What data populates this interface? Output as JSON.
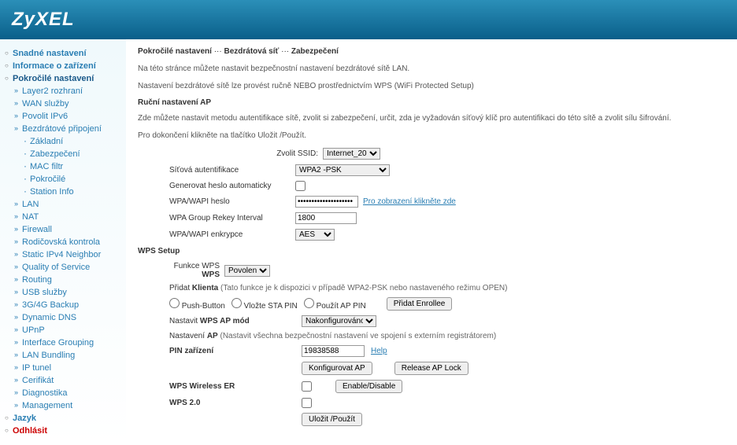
{
  "app": {
    "logo": "ZyXEL"
  },
  "sidebar": [
    {
      "t": "top",
      "label": "Snadné nastavení",
      "bold": true
    },
    {
      "t": "top",
      "label": "Informace o zařízení",
      "bold": true
    },
    {
      "t": "top",
      "label": "Pokročilé nastavení",
      "bold": true,
      "active": true
    },
    {
      "t": "sub",
      "label": "Layer2 rozhraní"
    },
    {
      "t": "sub",
      "label": "WAN služby"
    },
    {
      "t": "sub",
      "label": "Povolit IPv6"
    },
    {
      "t": "sub",
      "label": "Bezdrátové připojení"
    },
    {
      "t": "sub2",
      "label": "Základní"
    },
    {
      "t": "sub2",
      "label": "Zabezpečení"
    },
    {
      "t": "sub2",
      "label": "MAC filtr"
    },
    {
      "t": "sub2",
      "label": "Pokročilé"
    },
    {
      "t": "sub2",
      "label": "Station Info"
    },
    {
      "t": "sub",
      "label": "LAN"
    },
    {
      "t": "sub",
      "label": "NAT"
    },
    {
      "t": "sub",
      "label": "Firewall"
    },
    {
      "t": "sub",
      "label": "Rodičovská kontrola"
    },
    {
      "t": "sub",
      "label": "Static IPv4 Neighbor"
    },
    {
      "t": "sub",
      "label": "Quality of Service"
    },
    {
      "t": "sub",
      "label": "Routing"
    },
    {
      "t": "sub",
      "label": "USB služby"
    },
    {
      "t": "sub",
      "label": "3G/4G Backup"
    },
    {
      "t": "sub",
      "label": "Dynamic DNS"
    },
    {
      "t": "sub",
      "label": "UPnP"
    },
    {
      "t": "sub",
      "label": "Interface Grouping"
    },
    {
      "t": "sub",
      "label": "LAN Bundling"
    },
    {
      "t": "sub",
      "label": "IP tunel"
    },
    {
      "t": "sub",
      "label": "Cerifikát"
    },
    {
      "t": "sub",
      "label": "Diagnostika"
    },
    {
      "t": "sub",
      "label": "Management"
    },
    {
      "t": "top",
      "label": "Jazyk",
      "bold": true
    },
    {
      "t": "top",
      "label": "Odhlásit",
      "bold": true,
      "logout": true
    }
  ],
  "breadcrumb": {
    "a": "Pokročilé nastavení",
    "b": "Bezdrátová síť",
    "c": "Zabezpečení",
    "sep": "···"
  },
  "intro1": "Na této stránce můžete nastavit bezpečnostní nastavení bezdrátové sítě LAN.",
  "intro2": "Nastavení bezdrátové sítě lze provést ručně   NEBO   prostřednictvím WPS (WiFi Protected Setup)",
  "manual": {
    "title": "Ruční nastavení AP",
    "desc": "Zde můžete nastavit metodu autentifikace sítě, zvolit si zabezpečení, určit, zda je vyžadován síťový klíč pro autentifikaci do této sítě a zvolit sílu šifrování.",
    "desc2": "Pro dokončení klikněte na tlačítko Uložit /Použít.",
    "ssid_label": "Zvolit SSID:",
    "ssid_value": "Internet_20",
    "auth_label": "Síťová autentifikace",
    "auth_value": "WPA2 -PSK",
    "gen_label": "Generovat heslo automaticky",
    "pass_label": "WPA/WAPI heslo",
    "pass_value": "••••••••••••••••••••",
    "pass_link": "Pro zobrazení klikněte zde",
    "rekey_label": "WPA Group Rekey Interval",
    "rekey_value": "1800",
    "enc_label": "WPA/WAPI enkrypce",
    "enc_value": "AES"
  },
  "wps": {
    "title": "WPS Setup",
    "func_label": "Funkce WPS",
    "func_value": "Povoleno",
    "client_pre": "Přidat ",
    "client_bold": "Klienta",
    "client_note": " (Tato funkce je k dispozici v případě WPA2-PSK nebo nastaveného režimu OPEN)",
    "opt_push": "Push-Button",
    "opt_sta": "Vložte STA PIN",
    "opt_ap": "Použít AP PIN",
    "add_btn": "Přidat Enrollee",
    "mode_pre": "Nastavit ",
    "mode_bold": "WPS AP mód",
    "mode_value": "Nakonfigurováno",
    "ap_pre": "Nastavení ",
    "ap_bold": "AP",
    "ap_note": " (Nastavit všechna bezpečnostní nastavení ve spojení s externím registrátorem)",
    "pin_label": "PIN zařízení",
    "pin_value": "19838588",
    "pin_help": "Help",
    "cfg_btn": "Konfigurovat AP",
    "rel_btn": "Release AP Lock",
    "er_label": "WPS Wireless ER",
    "er_btn": "Enable/Disable",
    "wps2_label": "WPS 2.0",
    "save_btn": "Uložit /Použít"
  }
}
